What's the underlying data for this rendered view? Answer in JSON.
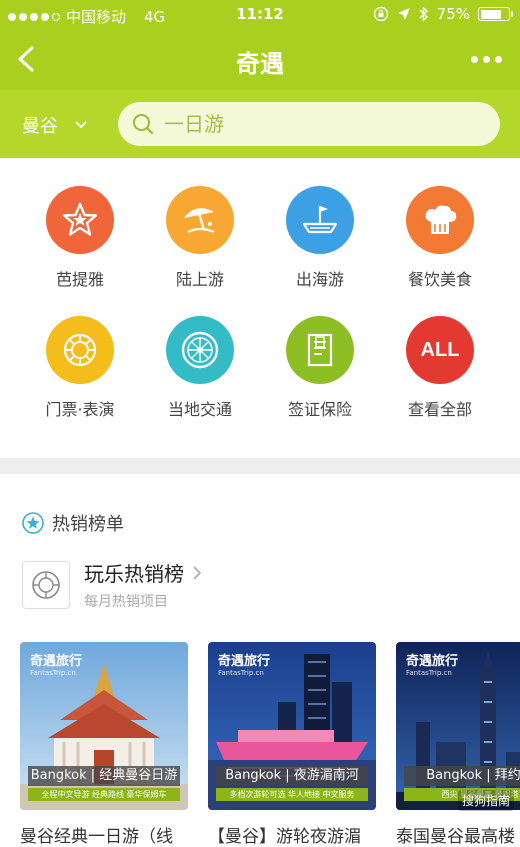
{
  "status_bar": {
    "carrier": "中国移动",
    "network": "4G",
    "time": "11:12",
    "battery": "75%",
    "battery_level": 0.75
  },
  "nav": {
    "title": "奇遇"
  },
  "search": {
    "city": "曼谷",
    "placeholder": "一日游"
  },
  "categories": [
    {
      "label": "芭提雅",
      "icon": "star-icon",
      "color": "#f0663a"
    },
    {
      "label": "陆上游",
      "icon": "beach-umbrella-icon",
      "color": "#f9a733"
    },
    {
      "label": "出海游",
      "icon": "boat-flag-icon",
      "color": "#3ea0e4"
    },
    {
      "label": "餐饮美食",
      "icon": "chef-hat-icon",
      "color": "#f27a35"
    },
    {
      "label": "门票·表演",
      "icon": "ticket-wheel-icon",
      "color": "#f4bd1b"
    },
    {
      "label": "当地交通",
      "icon": "wheel-icon",
      "color": "#33bcc6"
    },
    {
      "label": "签证保险",
      "icon": "document-icon",
      "color": "#8dbf24"
    },
    {
      "label": "查看全部",
      "icon": "all-icon",
      "color": "#e23a30",
      "text": "ALL"
    }
  ],
  "hot": {
    "section_title": "热销榜单",
    "rank_title": "玩乐热销榜",
    "rank_subtitle": "每月热销项目"
  },
  "cards": [
    {
      "brand": "奇遇旅行",
      "brand_sub": "FantasTrip.cn",
      "tag": "Bangkok | 经典曼谷日游",
      "tag_sub": "全程中文导游  经典路线  豪华保姆车",
      "caption": "曼谷经典一日游（线"
    },
    {
      "brand": "奇遇旅行",
      "brand_sub": "FantasTrip.cn",
      "tag": "Bangkok | 夜游湄南河",
      "tag_sub": "多档次游轮可选  华人地接  中文服务",
      "caption": "【曼谷】游轮夜游湄"
    },
    {
      "brand": "奇遇旅行",
      "brand_sub": "FantasTrip.cn",
      "tag": "Bangkok | 拜约克",
      "tag_sub": "西尖  曼谷最高  景观塔",
      "caption": "泰国曼谷最高楼"
    }
  ],
  "watermark": "搜狗指南",
  "colors": {
    "brand_green": "#a9cf1f",
    "search_band": "#b5d62b"
  }
}
